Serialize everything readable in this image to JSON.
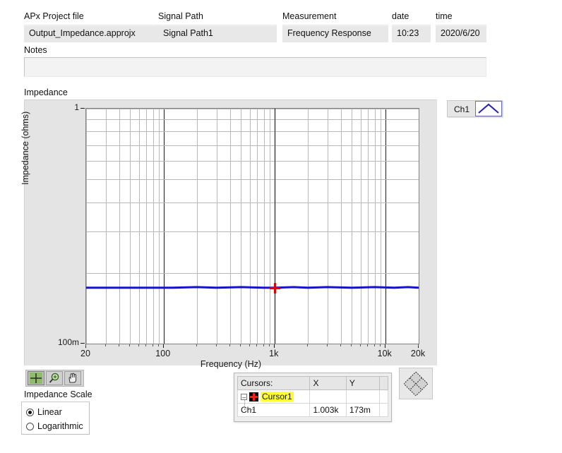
{
  "header": {
    "fields": [
      {
        "label": "APx Project file",
        "value": "Output_Impedance.approjx"
      },
      {
        "label": "Signal Path",
        "value": "Signal Path1"
      },
      {
        "label": "Measurement",
        "value": "Frequency Response"
      },
      {
        "label": "date",
        "value": "10:23"
      },
      {
        "label": "time",
        "value": "2020/6/20"
      }
    ],
    "notes_label": "Notes",
    "notes_value": "",
    "notes_placeholder": ""
  },
  "graph": {
    "title": "Impedance",
    "legend": {
      "series_label": "Ch1",
      "swatch_icon": "peak-line-icon",
      "color": "#1414c8"
    }
  },
  "chart_data": {
    "type": "line",
    "title": "Impedance",
    "xlabel": "Frequency (Hz)",
    "ylabel": "Impedance (ohms)",
    "xscale": "log",
    "yscale": "log",
    "xlim": [
      20,
      20000
    ],
    "ylim": [
      0.1,
      1
    ],
    "grid": true,
    "legend_position": "top-right-outside",
    "xtick_labels": [
      "20",
      "100",
      "1k",
      "10k",
      "20k"
    ],
    "xtick_values": [
      20,
      100,
      1000,
      10000,
      20000
    ],
    "ytick_labels": [
      "1",
      "100m"
    ],
    "ytick_values": [
      1,
      0.1
    ],
    "series": [
      {
        "name": "Ch1",
        "color": "#1414c8",
        "x": [
          20,
          30,
          50,
          80,
          120,
          200,
          300,
          500,
          800,
          1003,
          1500,
          2000,
          3000,
          5000,
          8000,
          12000,
          16000,
          20000
        ],
        "y": [
          0.173,
          0.173,
          0.173,
          0.173,
          0.173,
          0.174,
          0.173,
          0.174,
          0.173,
          0.173,
          0.174,
          0.173,
          0.174,
          0.173,
          0.174,
          0.173,
          0.174,
          0.173
        ]
      }
    ],
    "annotations": [
      {
        "name": "Cursor1",
        "x": 1003,
        "y": 0.173,
        "marker": "crosshair",
        "color": "#e10000"
      }
    ]
  },
  "toolbar": {
    "buttons": [
      {
        "name": "cursor-tool",
        "icon": "crosshair-icon",
        "active": true
      },
      {
        "name": "zoom-tool",
        "icon": "magnifier-plus-icon",
        "active": false
      },
      {
        "name": "pan-tool",
        "icon": "hand-icon",
        "active": false
      }
    ]
  },
  "scale": {
    "title": "Impedance Scale",
    "options": [
      {
        "label": "Linear",
        "selected": true
      },
      {
        "label": "Logarithmic",
        "selected": false
      }
    ]
  },
  "cursors": {
    "columns": [
      "Cursors:",
      "X",
      "Y",
      ""
    ],
    "rows": [
      {
        "name": "Cursor1",
        "x": "",
        "y": "",
        "level": 0,
        "highlight": true
      },
      {
        "name": "Ch1",
        "x": "1.003k",
        "y": "173m",
        "level": 1,
        "highlight": false
      }
    ]
  },
  "scale_mode_button": {
    "icon": "diamond-grid-icon"
  }
}
